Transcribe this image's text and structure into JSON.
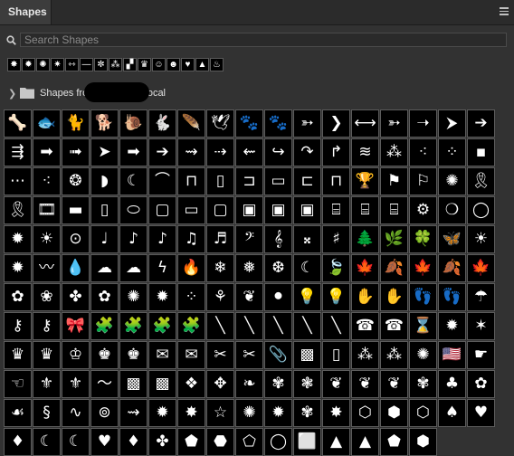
{
  "panel": {
    "title": "Shapes"
  },
  "search": {
    "placeholder": "Search Shapes"
  },
  "recent_shapes": [
    "✸",
    "✹",
    "✺",
    "✷",
    "⇿",
    "—",
    "✼",
    "⁂",
    "▞",
    "♛",
    "☺",
    "☻",
    "♥",
    "▲",
    "♨"
  ],
  "group": {
    "label_prefix": "Shapes fro",
    "label_suffix": "0.local"
  },
  "shapes": [
    "🦴",
    "🐟",
    "🐈",
    "🐕",
    "🐌",
    "🐇",
    "🪶",
    "🕊",
    "🐾",
    "🐾",
    "➳",
    "❯",
    "⟷",
    "➳",
    "➝",
    "⮞",
    "➔",
    "⇶",
    "➡",
    "➟",
    "➤",
    "➡",
    "➔",
    "⇝",
    "⇢",
    "⇜",
    "↪",
    "↷",
    "↱",
    "≋",
    "⁂",
    "⁖",
    "⁘",
    "▪",
    "⋯",
    "⁖",
    "❂",
    "◗",
    "☾",
    "⌒",
    "⊓",
    "▯",
    "⊐",
    "▭",
    "⊏",
    "⊓",
    "🏆",
    "⚑",
    "⚐",
    "✺",
    "🎗",
    "🎗",
    "🎞",
    "▬",
    "▯",
    "⬭",
    "▢",
    "▭",
    "▢",
    "▣",
    "▣",
    "▣",
    "⌸",
    "⌸",
    "⌸",
    "⚙",
    "❍",
    "◯",
    "✹",
    "☀",
    "⊙",
    "♩",
    "♪",
    "♪",
    "♫",
    "♬",
    "𝄢",
    "𝄞",
    "𝄪",
    "♯",
    "🌲",
    "🌿",
    "🍀",
    "🦋",
    "☀",
    "✹",
    "〰",
    "💧",
    "☁",
    "☁",
    "ϟ",
    "🔥",
    "❄",
    "❅",
    "❆",
    "☾",
    "🍃",
    "🍁",
    "🍂",
    "🍁",
    "🍂",
    "🍁",
    "✿",
    "❀",
    "✤",
    "✿",
    "✺",
    "✹",
    "⁘",
    "⚘",
    "❦",
    "⚫",
    "💡",
    "💡",
    "✋",
    "✋",
    "👣",
    "👣",
    "☂",
    "⚷",
    "⚷",
    "🎀",
    "🧩",
    "🧩",
    "🧩",
    "🧩",
    "╲",
    "╲",
    "╲",
    "╲",
    "╲",
    "☎",
    "☎",
    "⌛",
    "✹",
    "✶",
    "♛",
    "♛",
    "♔",
    "♚",
    "♚",
    "✉",
    "✉",
    "✂",
    "✂",
    "📎",
    "▩",
    "▯",
    "⁂",
    "⁂",
    "✺",
    "🇺🇸",
    "☛",
    "☜",
    "⚜",
    "⚜",
    "〜",
    "▩",
    "▩",
    "❖",
    "✥",
    "❧",
    "✾",
    "❃",
    "❦",
    "❦",
    "❦",
    "✾",
    "♣",
    "✿",
    "☙",
    "§",
    "∿",
    "⊚",
    "⇝",
    "✹",
    "✸",
    "☆",
    "✺",
    "✹",
    "✾",
    "✸",
    "⬡",
    "⬢",
    "⬡",
    "♠",
    "♥",
    "♦",
    "☾",
    "☾",
    "♥",
    "♦",
    "✤",
    "⬟",
    "⬣",
    "⬠",
    "◯",
    "⬜",
    "▲",
    "▲",
    "⬟",
    "⬢"
  ]
}
